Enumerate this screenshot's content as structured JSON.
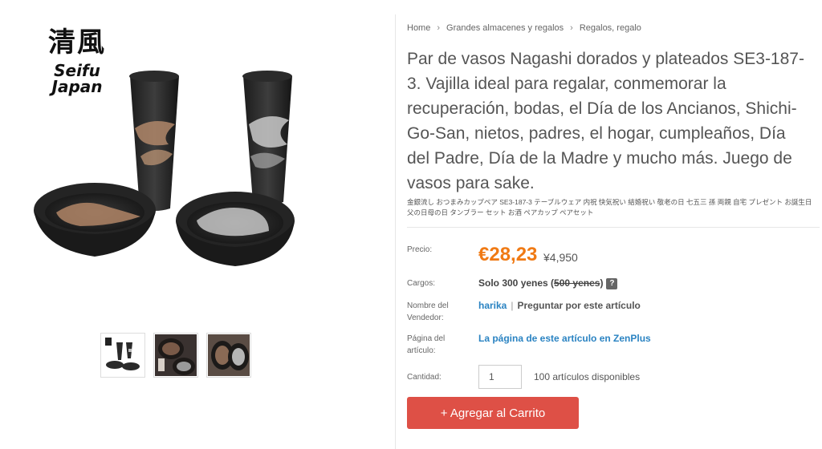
{
  "brand": {
    "kanji": "清風",
    "latin_line1": "Seifu",
    "latin_line2": "Japan"
  },
  "gallery": {
    "thumbnail_count": 3
  },
  "breadcrumb": {
    "items": [
      "Home",
      "Grandes almacenes y regalos",
      "Regalos, regalo"
    ],
    "separator": "›"
  },
  "product": {
    "title": "Par de vasos Nagashi dorados y plateados SE3-187-3. Vajilla ideal para regalar, conmemorar la recuperación, bodas, el Día de los Ancianos, Shichi-Go-San, nietos, padres, el hogar, cumpleaños, Día del Padre, Día de la Madre y mucho más. Juego de vasos para sake.",
    "subtitle": "金銀流し おつまみカップペア SE3-187-3 テーブルウェア 内祝 快気祝い 結婚祝い 敬老の日 七五三 孫 両親 自宅 プレゼント お誕生日 父の日母の日 タンブラー セット お酒 ペアカップ ペアセット"
  },
  "details": {
    "price_label": "Precio:",
    "price_eur": "€28,23",
    "price_yen": "¥4,950",
    "shipping_label": "Cargos:",
    "shipping_text": "Solo 300 yenes (",
    "shipping_strike": "500 yenes",
    "shipping_close": ")",
    "shipping_help": "?",
    "seller_label": "Nombre del Vendedor:",
    "seller_name": "harika",
    "seller_separator": "|",
    "ask_label": "Preguntar por este artículo",
    "page_label": "Página del artículo:",
    "page_link": "La página de este artículo en ZenPlus",
    "quantity_label": "Cantidad:",
    "quantity_value": "1",
    "stock_text": "100 artículos disponibles",
    "cart_button": "+ Agregar al Carrito"
  },
  "colors": {
    "price": "#f07a14",
    "link": "#2a83c2",
    "cart_button": "#de5046"
  }
}
